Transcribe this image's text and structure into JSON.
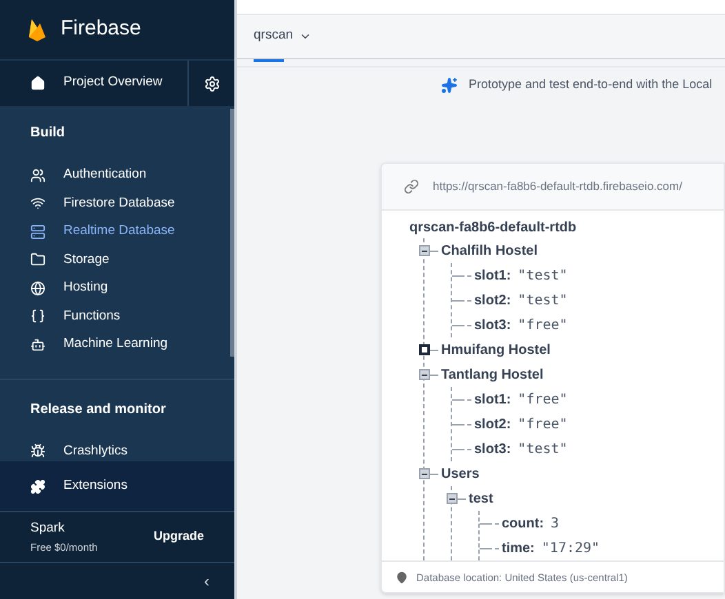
{
  "brand": {
    "name": "Firebase"
  },
  "project_overview": {
    "label": "Project Overview"
  },
  "sections": [
    {
      "title": "Build",
      "items": [
        {
          "label": "Authentication",
          "selected": false
        },
        {
          "label": "Firestore Database",
          "selected": false
        },
        {
          "label": "Realtime Database",
          "selected": true
        },
        {
          "label": "Storage",
          "selected": false
        },
        {
          "label": "Hosting",
          "selected": false
        },
        {
          "label": "Functions",
          "selected": false
        },
        {
          "label": "Machine Learning",
          "selected": false
        }
      ]
    },
    {
      "title": "Release and monitor",
      "items": [
        {
          "label": "Crashlytics",
          "selected": false
        }
      ]
    }
  ],
  "extensions": {
    "label": "Extensions"
  },
  "plan": {
    "name": "Spark",
    "price": "Free $0/month",
    "action": "Upgrade"
  },
  "collapse": {
    "symbol": "‹"
  },
  "header": {
    "project": "qrscan"
  },
  "banner": {
    "text": "Prototype and test end-to-end with the Local"
  },
  "database": {
    "url": "https://qrscan-fa8b6-default-rtdb.firebaseio.com/",
    "root": "qrscan-fa8b6-default-rtdb",
    "tree": [
      {
        "kind": "node",
        "label": "Chalfilh Hostel",
        "expanded": true,
        "children": [
          {
            "kind": "leaf",
            "key": "slot1:",
            "value": "\"test\""
          },
          {
            "kind": "leaf",
            "key": "slot2:",
            "value": "\"test\""
          },
          {
            "kind": "leaf",
            "key": "slot3:",
            "value": "\"free\""
          }
        ]
      },
      {
        "kind": "node",
        "label": "Hmuifang Hostel",
        "expanded": false
      },
      {
        "kind": "node",
        "label": "Tantlang Hostel",
        "expanded": true,
        "children": [
          {
            "kind": "leaf",
            "key": "slot1:",
            "value": "\"free\""
          },
          {
            "kind": "leaf",
            "key": "slot2:",
            "value": "\"free\""
          },
          {
            "kind": "leaf",
            "key": "slot3:",
            "value": "\"test\""
          }
        ]
      },
      {
        "kind": "node",
        "label": "Users",
        "expanded": true,
        "children": [
          {
            "kind": "node",
            "label": "test",
            "expanded": true,
            "children": [
              {
                "kind": "leaf",
                "key": "count:",
                "value": "3"
              },
              {
                "kind": "leaf",
                "key": "time:",
                "value": "\"17:29\""
              }
            ]
          }
        ]
      }
    ],
    "location": "Database location: United States (us-central1)"
  }
}
